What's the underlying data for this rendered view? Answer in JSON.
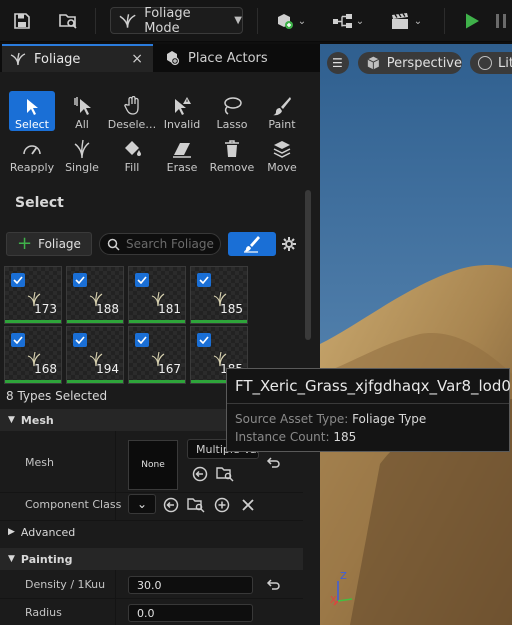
{
  "toolbar": {
    "mode_label": "Foliage Mode",
    "icons": [
      "save-icon",
      "content-browser-icon",
      "foliage-icon",
      "add-actor-icon",
      "blueprint-icon",
      "cinematics-icon",
      "play-icon",
      "pause-icon"
    ],
    "accent_color": "#1a6fd6",
    "play_color": "#3fb14a"
  },
  "tabs": [
    {
      "label": "Foliage",
      "close": "×"
    },
    {
      "label": "Place Actors"
    }
  ],
  "tools": [
    {
      "label": "Select",
      "icon": "cursor-icon",
      "active": true
    },
    {
      "label": "All",
      "icon": "select-all-icon"
    },
    {
      "label": "Deselect",
      "display": "Desele…",
      "icon": "deselect-icon"
    },
    {
      "label": "Invalid",
      "icon": "invalid-icon"
    },
    {
      "label": "Lasso",
      "icon": "lasso-icon"
    },
    {
      "label": "Paint",
      "icon": "brush-icon"
    },
    {
      "label": "Reapply",
      "icon": "reapply-icon"
    },
    {
      "label": "Single",
      "icon": "single-icon"
    },
    {
      "label": "Fill",
      "icon": "fill-icon"
    },
    {
      "label": "Erase",
      "icon": "erase-icon"
    },
    {
      "label": "Remove",
      "icon": "trash-icon"
    },
    {
      "label": "Move",
      "icon": "move-icon"
    }
  ],
  "section_title": "Select",
  "add_button": "Foliage",
  "search": {
    "placeholder": "Search Foliage",
    "value": ""
  },
  "tiles": [
    {
      "count": "173",
      "checked": true
    },
    {
      "count": "188",
      "checked": true
    },
    {
      "count": "181",
      "checked": true
    },
    {
      "count": "185",
      "checked": true
    },
    {
      "count": "168",
      "checked": true
    },
    {
      "count": "194",
      "checked": true
    },
    {
      "count": "167",
      "checked": true
    },
    {
      "count": "185",
      "checked": true
    }
  ],
  "types_selected": "8 Types Selected",
  "details": {
    "mesh_section": "Mesh",
    "mesh_label": "Mesh",
    "mesh_thumb": "None",
    "mesh_value": "Multiple Values",
    "component_class_label": "Component Class",
    "advanced_label": "Advanced",
    "painting_section": "Painting",
    "density_label": "Density / 1Kuu",
    "density_value": "30.0",
    "radius_label": "Radius",
    "radius_value": "0.0"
  },
  "viewport": {
    "perspective_label": "Perspective",
    "lit_label": "Lit",
    "axis_z": "Z",
    "axis_x": "X"
  },
  "tooltip": {
    "title": "FT_Xeric_Grass_xjfgdhaqx_Var8_lod0",
    "source_key": "Source Asset Type:",
    "source_value": "Foliage Type",
    "count_key": "Instance Count:",
    "count_value": "185"
  }
}
